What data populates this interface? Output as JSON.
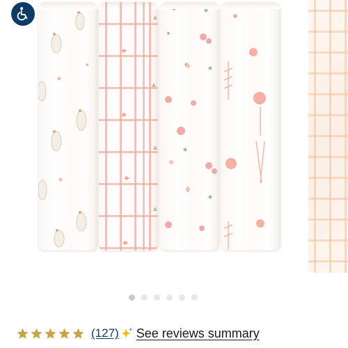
{
  "accessibility": {
    "icon": "accessibility-icon",
    "color": "#0d3b66"
  },
  "carousel": {
    "product_image": "four muslin swaddles: geese, pink grid, floral, botanical",
    "dot_count": 6,
    "active_index": 0
  },
  "rating": {
    "stars": 5,
    "star_color": "#c9a447",
    "count_label": "(127)",
    "sparkle_icon": "sparkle-icon",
    "summary_link": "See reviews summary"
  }
}
